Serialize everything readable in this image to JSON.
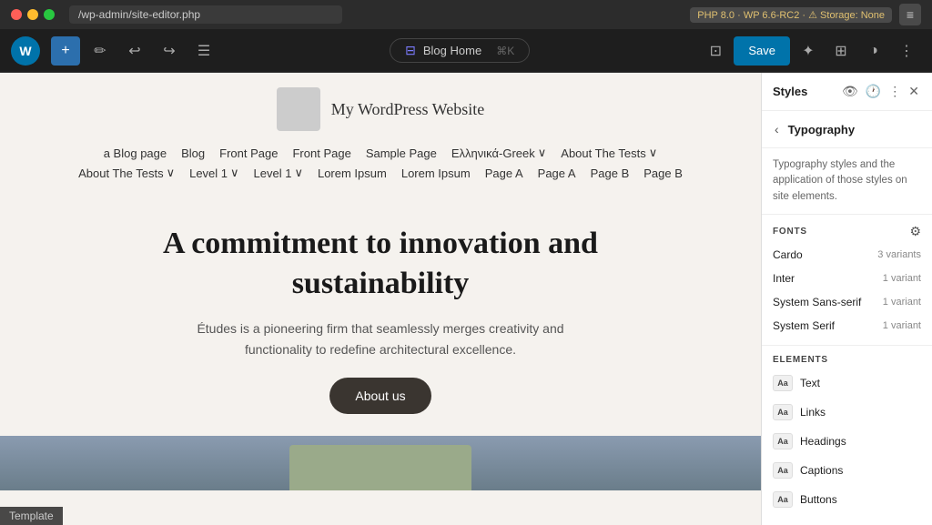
{
  "titlebar": {
    "url": "/wp-admin/site-editor.php",
    "php_info": "PHP 8.0 · WP 6.6-RC2 · ⚠ Storage: None"
  },
  "toolbar": {
    "wp_logo": "W",
    "add_label": "+",
    "blog_home_label": "Blog Home",
    "blog_home_icon": "⊟",
    "shortcut": "⌘K",
    "save_label": "Save"
  },
  "canvas": {
    "site_title": "My WordPress Website",
    "nav_row1": [
      "a Blog page",
      "Blog",
      "Front Page",
      "Front Page",
      "Sample Page",
      "Ελληνικά-Greek ∨",
      "About The Tests ∨"
    ],
    "nav_row2": [
      "About The Tests ∨",
      "Level 1 ∨",
      "Level 1 ∨",
      "Lorem Ipsum",
      "Lorem Ipsum",
      "Page A",
      "Page A",
      "Page B",
      "Page B"
    ],
    "hero_title": "A commitment to innovation and sustainability",
    "hero_subtitle": "Études is a pioneering firm that seamlessly merges creativity and functionality to redefine architectural excellence.",
    "hero_btn": "About us",
    "template_label": "Template"
  },
  "sidebar": {
    "title": "Styles",
    "typography_title": "Typography",
    "typography_desc": "Typography styles and the application of those styles on site elements.",
    "fonts_label": "FONTS",
    "fonts": [
      {
        "name": "Cardo",
        "variants": "3 variants"
      },
      {
        "name": "Inter",
        "variants": "1 variant"
      },
      {
        "name": "System Sans-serif",
        "variants": "1 variant"
      },
      {
        "name": "System Serif",
        "variants": "1 variant"
      }
    ],
    "elements_label": "ELEMENTS",
    "elements": [
      {
        "icon": "Aa",
        "label": "Text"
      },
      {
        "icon": "Aa",
        "label": "Links"
      },
      {
        "icon": "Aa",
        "label": "Headings"
      },
      {
        "icon": "Aa",
        "label": "Captions"
      },
      {
        "icon": "Aa",
        "label": "Buttons"
      }
    ]
  }
}
